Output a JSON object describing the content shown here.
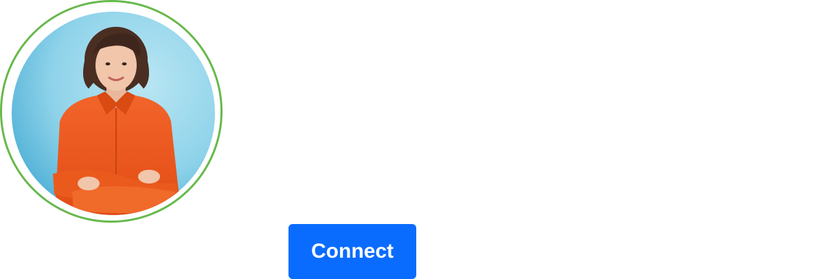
{
  "profile": {
    "avatar_icon": "person-photo-icon",
    "ring_color": "#66b84a",
    "photo_background": "#8fd3ea",
    "shirt_color": "#ef5a1f"
  },
  "actions": {
    "connect_label": "Connect",
    "connect_color": "#0a6cff"
  }
}
